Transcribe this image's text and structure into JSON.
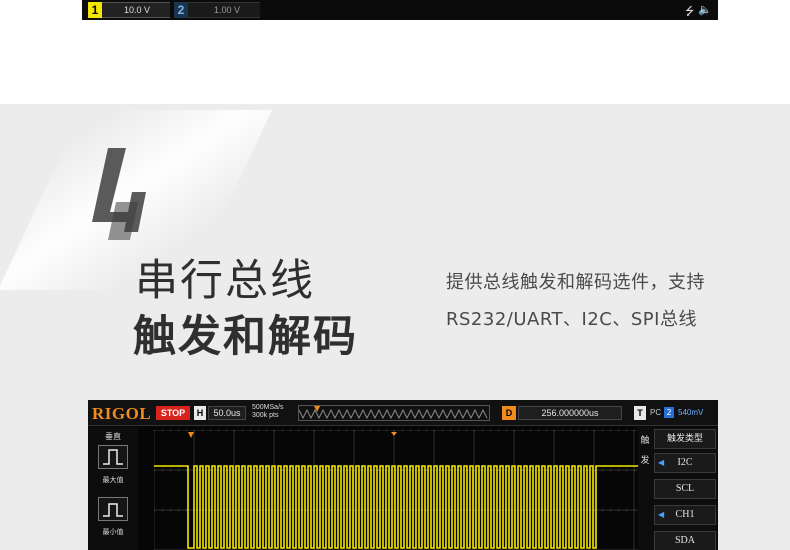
{
  "top_bar": {
    "ch1": {
      "num": "1",
      "scale": "10.0 V"
    },
    "ch2": {
      "num": "2",
      "scale": "1.00 V"
    },
    "icons": [
      "usb-icon",
      "speaker-icon"
    ]
  },
  "promo": {
    "number": "4",
    "title_line1": "串行总线",
    "title_line2": "触发和解码",
    "desc_line1": "提供总线触发和解码选件，支持",
    "desc_line2": "RS232/UART、I2C、SPI总线"
  },
  "scope": {
    "logo": "RIGOL",
    "status": "STOP",
    "h_label": "H",
    "timebase": "50.0us",
    "sample_rate": "500MSa/s",
    "mem_depth": "300k pts",
    "d_label": "D",
    "delay": "256.000000us",
    "t_label": "T",
    "trigger_source": "PC",
    "trigger_channel": "2",
    "trigger_level": "540mV",
    "left_panel": {
      "title": "垂直",
      "btn1_label": "最大值",
      "btn2_label": "最小值"
    },
    "right_panel": {
      "side1": "触",
      "side2": "发",
      "title": "触发类型",
      "item1": "I2C",
      "item2": "SCL",
      "item3": "CH1",
      "item4": "SDA"
    }
  },
  "colors": {
    "waveform": "#f3e600",
    "accent_orange": "#f08c1c",
    "stop_red": "#d8231d",
    "band_gray": "#ececec",
    "text_dark": "#2f2f2f"
  }
}
